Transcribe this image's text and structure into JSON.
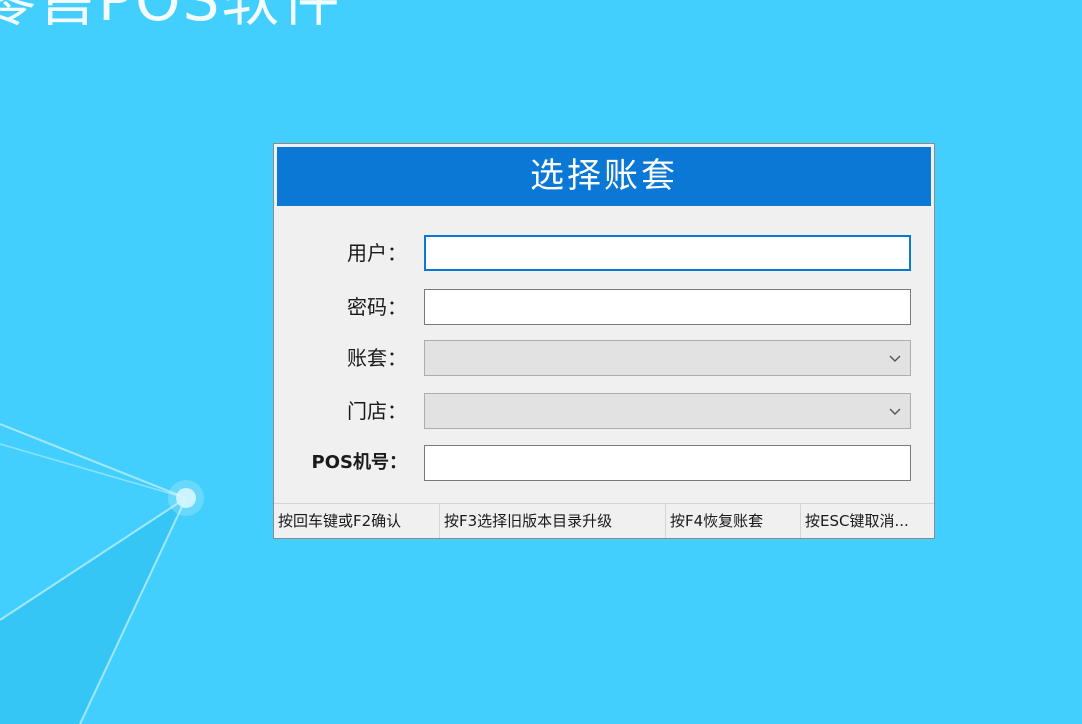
{
  "background": {
    "title": "零售POS软件"
  },
  "dialog": {
    "title": "选择账套",
    "fields": {
      "user": {
        "label": "用户：",
        "value": ""
      },
      "password": {
        "label": "密码：",
        "value": ""
      },
      "account_set": {
        "label": "账套：",
        "value": ""
      },
      "store": {
        "label": "门店：",
        "value": ""
      },
      "pos_number": {
        "label": "POS机号：",
        "value": ""
      }
    },
    "status": [
      "按回车键或F2确认",
      "按F3选择旧版本目录升级",
      "按F4恢复账套",
      "按ESC键取消..."
    ]
  },
  "colors": {
    "background": "#43cffd",
    "header": "#0a78d4",
    "dialog": "#f0f0f0"
  }
}
